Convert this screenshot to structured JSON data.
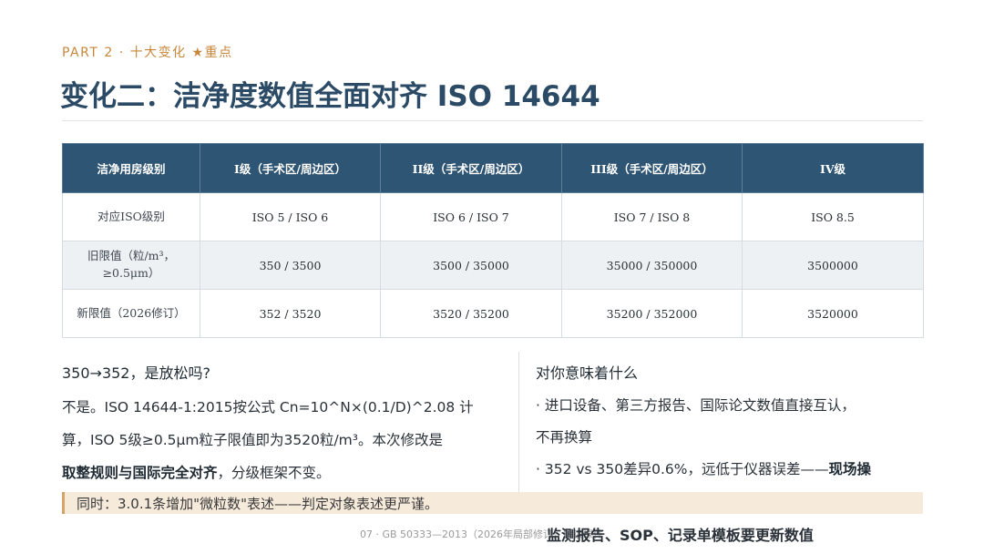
{
  "header": {
    "kicker": "PART 2 · 十大变化 ★重点",
    "title": "变化二：洁净度数值全面对齐 ISO 14644"
  },
  "table": {
    "columns": [
      "洁净用房级别",
      "I级（手术区/周边区）",
      "II级（手术区/周边区）",
      "III级（手术区/周边区）",
      "IV级"
    ],
    "rows": [
      {
        "label": "对应ISO级别",
        "cells": [
          "ISO 5 / ISO 6",
          "ISO 6 / ISO 7",
          "ISO 7 / ISO 8",
          "ISO 8.5"
        ]
      },
      {
        "label": "旧限值（粒/m³，≥0.5μm）",
        "cells": [
          "350 / 3500",
          "3500 / 35000",
          "35000 / 350000",
          "3500000"
        ]
      },
      {
        "label": "新限值（2026修订）",
        "cells": [
          "352 / 3520",
          "3520 / 35200",
          "35200 / 352000",
          "3520000"
        ]
      }
    ]
  },
  "left": {
    "question": "350→352，是放松吗?",
    "line1": "不是。ISO 14644-1:2015按公式 Cn=10^N×(0.1/D)^2.08 计",
    "line2": "算，ISO 5级≥0.5μm粒子限值即为3520粒/m³。本次修改是",
    "line3_em": "取整规则与国际完全对齐",
    "line3_rest": "，分级框架不变。"
  },
  "right": {
    "heading": "对你意味着什么",
    "item1a": "· 进口设备、第三方报告、国际论文数值直接互认，",
    "item1b": "不再换算",
    "item2_plain": "· 352 vs 350差异0.6%，远低于仪器误差——",
    "item2_em": "现场操",
    "overflow": "监测报告、SOP、记录单模板要更新数值"
  },
  "note": {
    "text": "同时：3.0.1条增加\"微粒数\"表述——判定对象表述更严谨。"
  },
  "footer": {
    "text": "07 · GB 50333—2013（2026年局部修订）解读课件"
  },
  "colors": {
    "accent": "#c7873b",
    "title": "#2b4a66",
    "table_header": "#2f5574",
    "note_bg": "#f6eadb"
  }
}
